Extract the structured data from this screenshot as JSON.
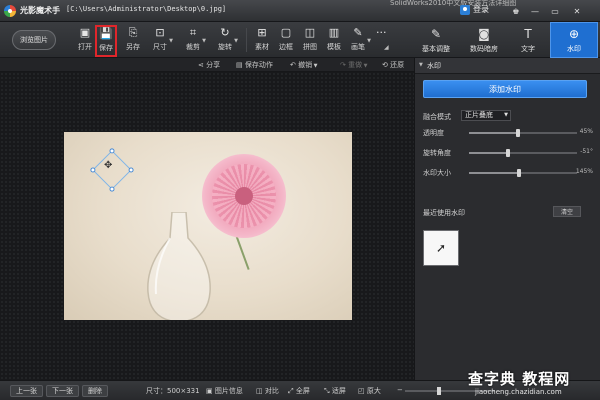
{
  "titlebar": {
    "app_name": "光影魔术手",
    "file_path": "[C:\\Users\\Administrator\\Desktop\\0.jpg]",
    "bg_caption": "SolidWorks2010中文版安装方法详细图",
    "login_label": "登录",
    "controls": [
      "♚",
      "—",
      "▭",
      "✕"
    ]
  },
  "toolbar": {
    "browse_label": "浏览图片",
    "tools": [
      {
        "id": "open",
        "label": "打开",
        "icon": "open-icon",
        "glyph": "▣"
      },
      {
        "id": "save",
        "label": "保存",
        "icon": "save-icon",
        "glyph": "💾"
      },
      {
        "id": "saveas",
        "label": "另存",
        "icon": "saveas-icon",
        "glyph": "⎘"
      },
      {
        "id": "size",
        "label": "尺寸",
        "icon": "resize-icon",
        "glyph": "⊡"
      },
      {
        "id": "crop",
        "label": "裁剪",
        "icon": "crop-icon",
        "glyph": "⌗"
      },
      {
        "id": "rotate",
        "label": "旋转",
        "icon": "rotate-icon",
        "glyph": "↻"
      },
      {
        "id": "material",
        "label": "素材",
        "icon": "material-icon",
        "glyph": "⊞"
      },
      {
        "id": "border",
        "label": "边框",
        "icon": "border-icon",
        "glyph": "▢"
      },
      {
        "id": "collage",
        "label": "拼图",
        "icon": "collage-icon",
        "glyph": "◫"
      },
      {
        "id": "template",
        "label": "模板",
        "icon": "template-icon",
        "glyph": "▥"
      },
      {
        "id": "brush",
        "label": "画笔",
        "icon": "brush-icon",
        "glyph": "✎"
      },
      {
        "id": "more",
        "label": "···",
        "icon": "more-icon",
        "glyph": ""
      }
    ]
  },
  "right_tabs": [
    {
      "label": "基本调整",
      "icon": "adjust-icon",
      "glyph": "✎"
    },
    {
      "label": "数码暗房",
      "icon": "camera-icon",
      "glyph": "◙"
    },
    {
      "label": "文字",
      "icon": "text-icon",
      "glyph": "T"
    },
    {
      "label": "水印",
      "icon": "watermark-icon",
      "glyph": "⊕"
    }
  ],
  "subbar": {
    "share": "分享",
    "save_action": "保存动作",
    "undo": "撤销",
    "redo": "重做",
    "restore": "还原"
  },
  "panel": {
    "title": "水印",
    "add_button": "添加水印",
    "blend_label": "融合模式",
    "blend_value": "正片叠底",
    "params": [
      {
        "label": "透明度",
        "value_text": "45%",
        "value": 0.45
      },
      {
        "label": "旋转角度",
        "value_text": "-51°",
        "value": 0.36
      },
      {
        "label": "水印大小",
        "value_text": "145%",
        "value": 0.46
      }
    ],
    "recent_title": "最近使用水印",
    "clear_label": "清空"
  },
  "bottombar": {
    "prev": "上一张",
    "next": "下一张",
    "delete": "删除",
    "size_text": "尺寸：500×331",
    "info": "图片信息",
    "compare": "对比",
    "fullscreen": "全屏",
    "fit": "适屏",
    "original": "原大",
    "zoom": 0.38
  },
  "site": {
    "logo": "查字典 教程网",
    "url": "jiaocheng.chazidian.com"
  }
}
